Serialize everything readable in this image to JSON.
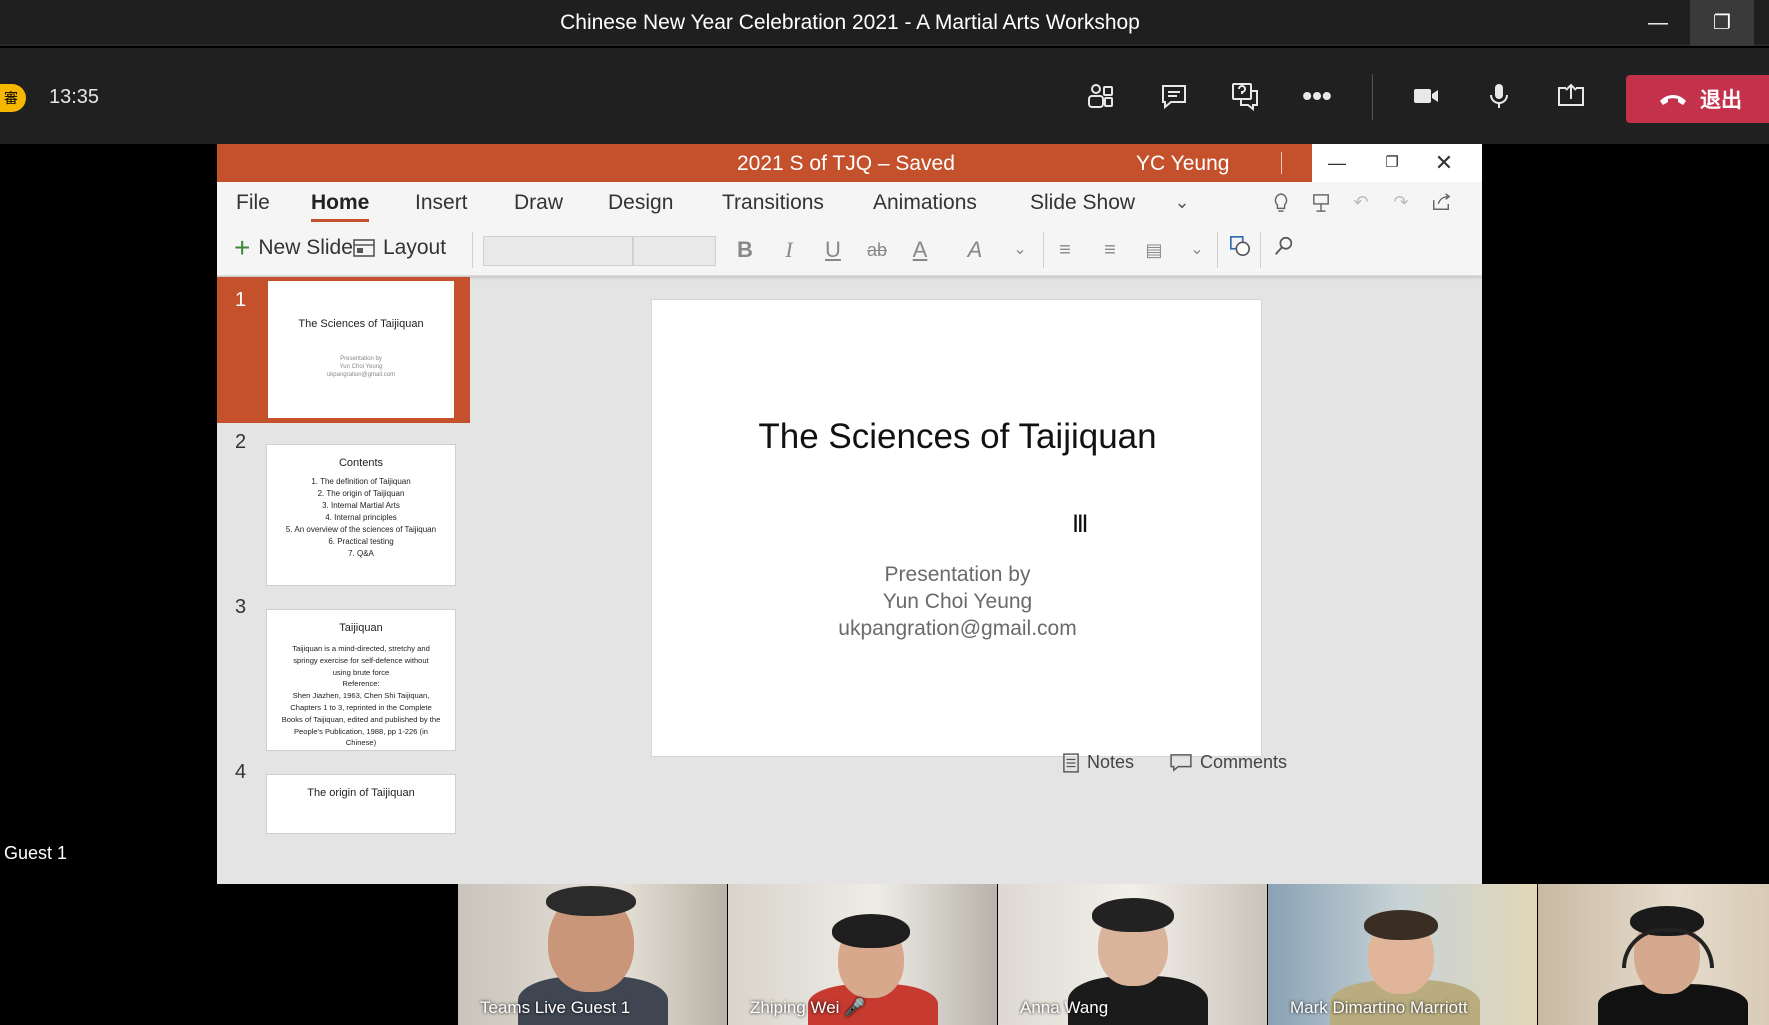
{
  "teams": {
    "window_title": "Chinese New Year Celebration 2021 - A Martial Arts Workshop",
    "timer": "13:35",
    "badge": "審",
    "leave_label": "退出",
    "guest_label": "Guest 1"
  },
  "ppt": {
    "doc_title": "2021 S of TJQ – Saved",
    "user": "YC Yeung",
    "tabs": [
      "File",
      "Home",
      "Insert",
      "Draw",
      "Design",
      "Transitions",
      "Animations",
      "Slide Show"
    ],
    "commands": {
      "new_slide": "New Slide",
      "layout": "Layout"
    },
    "status": {
      "notes": "Notes",
      "comments": "Comments"
    },
    "thumbnails": [
      {
        "num": "1",
        "title": "The Sciences of Taijiquan",
        "lines": [
          "Presentation by",
          "Yun Choi Yeung",
          "ukpangration@gmail.com"
        ]
      },
      {
        "num": "2",
        "title": "Contents",
        "lines": [
          "1.  The definition of Taijiquan",
          "2.  The origin of Taijiquan",
          "3.  Internal Martial Arts",
          "4.  Internal principles",
          "5.  An overview of the sciences of Taijiquan",
          "6.  Practical testing",
          "7.  Q&A"
        ]
      },
      {
        "num": "3",
        "title": "Taijiquan",
        "lines": [
          "Taijiquan is a mind-directed, stretchy and",
          "springy exercise for self-defence without",
          "using brute force",
          "Reference:",
          "Shen Jiazhen, 1963, Chen Shi Taijiquan,",
          "Chapters 1 to 3, reprinted in the Complete",
          "Books of Taijiquan,  edited and published by the",
          "People's Publication, 1988, pp 1-226 (in",
          "Chinese)"
        ]
      },
      {
        "num": "4",
        "title": "The origin of Taijiquan",
        "lines": []
      }
    ],
    "slide": {
      "title": "The Sciences of Taijiquan",
      "sub1": "Presentation by",
      "sub2": "Yun Choi Yeung",
      "sub3": "ukpangration@gmail.com"
    }
  },
  "participants": [
    {
      "name": "Teams Live Guest 1"
    },
    {
      "name": "Zhiping Wei"
    },
    {
      "name": "Anna Wang"
    },
    {
      "name": "Mark Dimartino Marriott"
    },
    {
      "name": ""
    }
  ],
  "colors": {
    "ppt_accent": "#c5512c",
    "leave_red": "#c4314b",
    "badge": "#f6b700"
  }
}
